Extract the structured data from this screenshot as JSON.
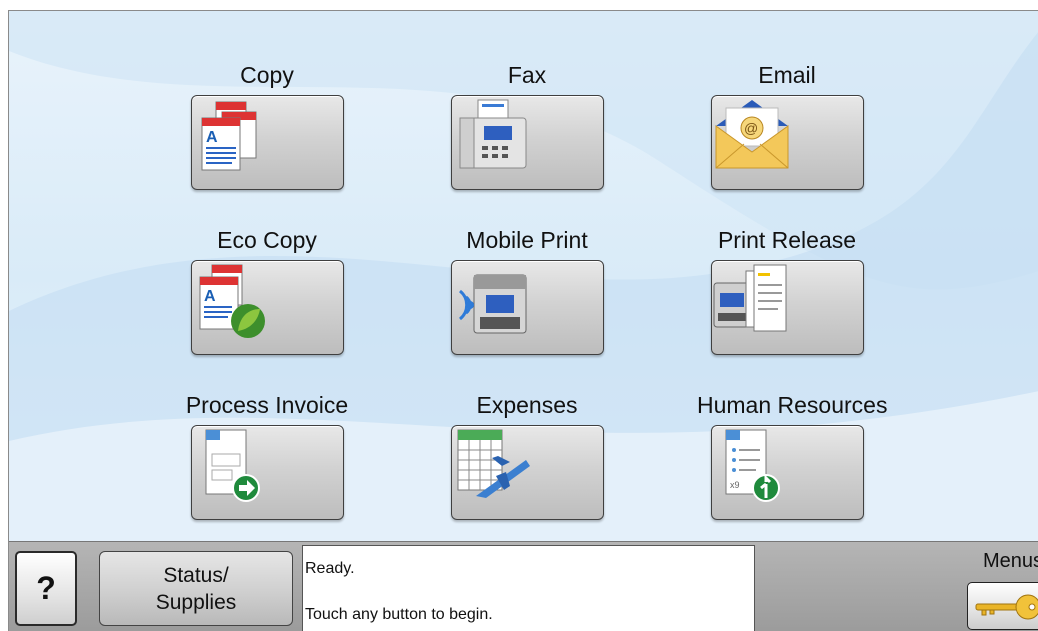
{
  "apps": [
    {
      "label": "Copy",
      "icon": "copy-icon"
    },
    {
      "label": "Fax",
      "icon": "fax-icon"
    },
    {
      "label": "Email",
      "icon": "email-icon"
    },
    {
      "label": "Eco Copy",
      "icon": "eco-copy-icon"
    },
    {
      "label": "Mobile Print",
      "icon": "mobile-print-icon"
    },
    {
      "label": "Print Release",
      "icon": "print-release-icon"
    },
    {
      "label": "Process Invoice",
      "icon": "process-invoice-icon"
    },
    {
      "label": "Expenses",
      "icon": "expenses-icon"
    },
    {
      "label": "Human Resources",
      "icon": "human-resources-icon"
    }
  ],
  "bottom_bar": {
    "help_label": "?",
    "status_line1": "Status/",
    "status_line2": "Supplies",
    "message_line1": "Ready.",
    "message_line2": "Touch any button to begin.",
    "menus_label": "Menus",
    "menus_icon": "key-icon"
  },
  "colors": {
    "background": "#dcecf8",
    "button_gray": "#cfcfcf",
    "bottom_bar": "#a8a8a8"
  }
}
